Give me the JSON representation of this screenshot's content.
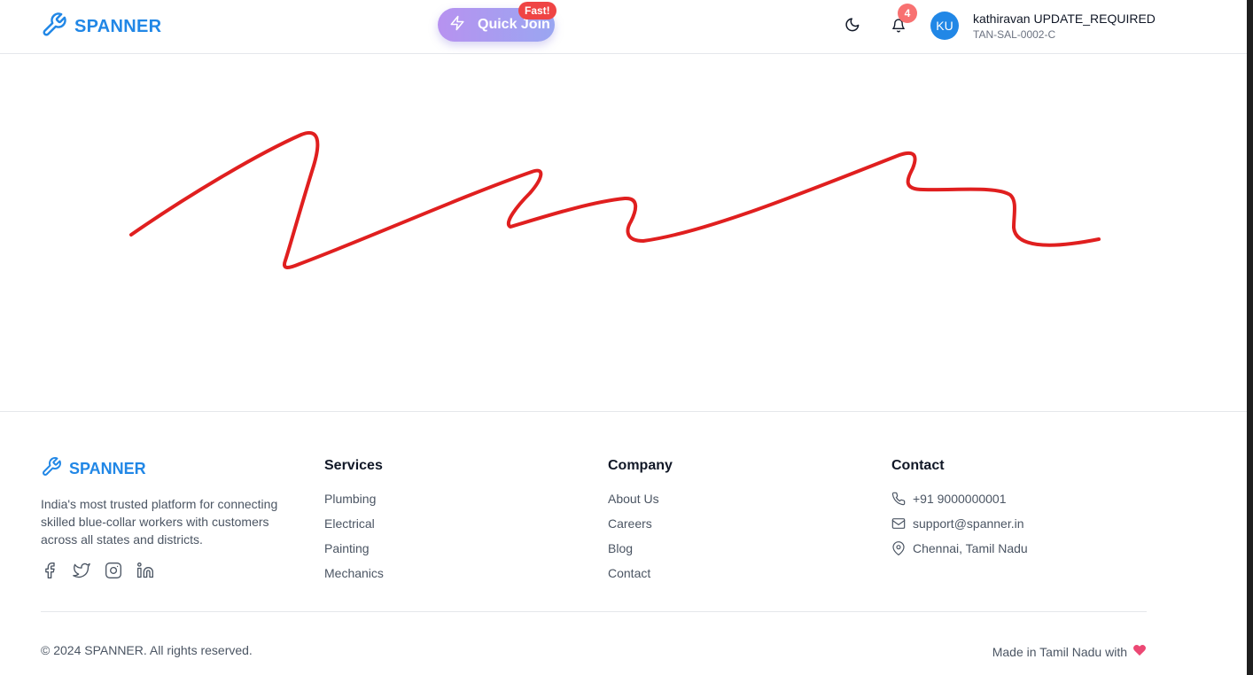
{
  "header": {
    "brand": "SPANNER",
    "quick_join_label": "Quick Join",
    "quick_join_badge": "Fast!",
    "notification_count": "4",
    "user": {
      "initials": "KU",
      "name": "kathiravan UPDATE_REQUIRED",
      "id": "TAN-SAL-0002-C"
    },
    "icons": [
      "wrench-icon",
      "lightning-icon",
      "moon-icon",
      "bell-icon"
    ]
  },
  "main": {
    "annotation_color": "#e01f1f",
    "content": "handwritten red scribble"
  },
  "footer": {
    "brand": "SPANNER",
    "description": "India's most trusted platform for connecting skilled blue-collar workers with customers across all states and districts.",
    "social_icons": [
      "facebook-icon",
      "twitter-icon",
      "instagram-icon",
      "linkedin-icon"
    ],
    "services": {
      "title": "Services",
      "items": [
        "Plumbing",
        "Electrical",
        "Painting",
        "Mechanics"
      ]
    },
    "company": {
      "title": "Company",
      "items": [
        "About Us",
        "Careers",
        "Blog",
        "Contact"
      ]
    },
    "contact": {
      "title": "Contact",
      "phone": "+91 9000000001",
      "email": "support@spanner.in",
      "location": "Chennai, Tamil Nadu"
    },
    "copyright": "© 2024 SPANNER. All rights reserved.",
    "made_in": "Made in Tamil Nadu with"
  },
  "colors": {
    "brand": "#2187e6",
    "badge": "#ef4444",
    "quick_join_gradient_start": "#b792f0",
    "quick_join_gradient_end": "#9aa6f1",
    "heart": "#ec4874"
  }
}
